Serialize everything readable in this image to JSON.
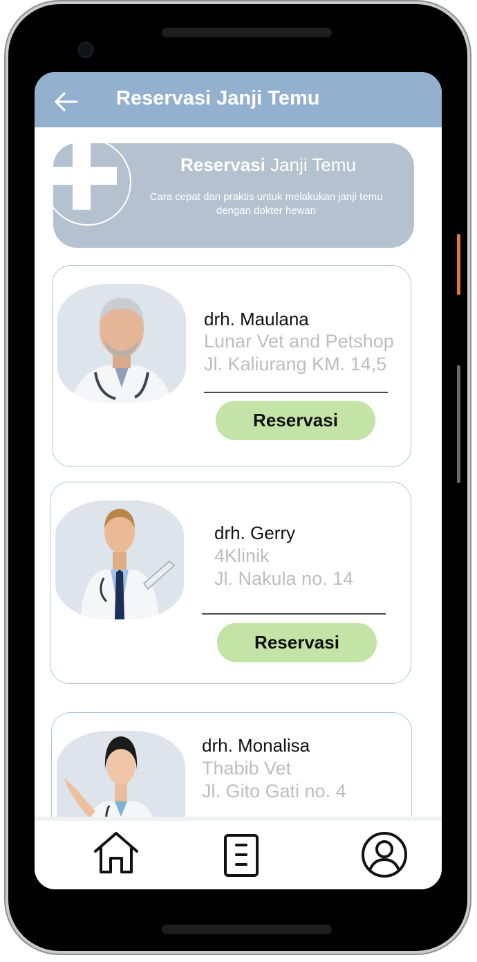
{
  "appbar": {
    "title": "Reservasi Janji Temu",
    "back_icon": "arrow-left-icon"
  },
  "banner": {
    "title_bold": "Reservasi",
    "title_rest": " Janji Temu",
    "description": "Cara cepat dan praktis untuk melakukan janji temu dengan dokter hewan",
    "icon": "medical-cross-icon"
  },
  "doctors": [
    {
      "name": "drh. Maulana",
      "clinic": "Lunar Vet and Petshop",
      "address": "Jl. Kaliurang KM. 14,5",
      "button_label": "Reservasi"
    },
    {
      "name": "drh. Gerry",
      "clinic": "4Klinik",
      "address": "Jl. Nakula no. 14",
      "button_label": "Reservasi"
    },
    {
      "name": "drh. Monalisa",
      "clinic": "Thabib Vet",
      "address": "Jl. Gito Gati no. 4"
    }
  ],
  "bottom_nav": {
    "items": [
      "home-icon",
      "document-list-icon",
      "profile-icon"
    ]
  },
  "colors": {
    "appbar": "#93b1cf",
    "banner": "#b3c2ce",
    "button": "#c4e3a7",
    "card_border": "#b5c4d6",
    "secondary_text": "#bdbdbd"
  }
}
